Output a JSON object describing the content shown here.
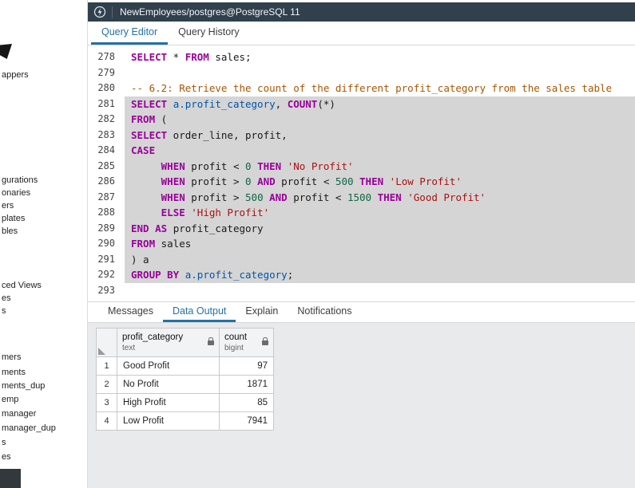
{
  "connection": {
    "title": "NewEmployees/postgres@PostgreSQL 11"
  },
  "editor_tabs": {
    "query_editor": "Query Editor",
    "query_history": "Query History"
  },
  "editor": {
    "selection": {
      "from": 281,
      "to": 292
    },
    "lines": [
      {
        "n": 278,
        "tokens": [
          [
            "kw",
            "SELECT"
          ],
          [
            "pl",
            " * "
          ],
          [
            "kw",
            "FROM"
          ],
          [
            "pl",
            " sales;"
          ]
        ]
      },
      {
        "n": 279,
        "tokens": []
      },
      {
        "n": 280,
        "tokens": [
          [
            "cmt",
            "-- 6.2: Retrieve the count of the different profit_category from the sales table"
          ]
        ]
      },
      {
        "n": 281,
        "tokens": [
          [
            "kw",
            "SELECT"
          ],
          [
            "pl",
            " "
          ],
          [
            "var",
            "a.profit_category"
          ],
          [
            "pl",
            ", "
          ],
          [
            "kw",
            "COUNT"
          ],
          [
            "pl",
            "(*)"
          ]
        ]
      },
      {
        "n": 282,
        "tokens": [
          [
            "kw",
            "FROM"
          ],
          [
            "pl",
            " ("
          ]
        ]
      },
      {
        "n": 283,
        "tokens": [
          [
            "kw",
            "SELECT"
          ],
          [
            "pl",
            " order_line, profit,"
          ]
        ]
      },
      {
        "n": 284,
        "tokens": [
          [
            "kw",
            "CASE"
          ]
        ]
      },
      {
        "n": 285,
        "tokens": [
          [
            "pl",
            "     "
          ],
          [
            "kw",
            "WHEN"
          ],
          [
            "pl",
            " profit < "
          ],
          [
            "num",
            "0"
          ],
          [
            "pl",
            " "
          ],
          [
            "kw",
            "THEN"
          ],
          [
            "pl",
            " "
          ],
          [
            "str",
            "'No Profit'"
          ]
        ]
      },
      {
        "n": 286,
        "tokens": [
          [
            "pl",
            "     "
          ],
          [
            "kw",
            "WHEN"
          ],
          [
            "pl",
            " profit > "
          ],
          [
            "num",
            "0"
          ],
          [
            "pl",
            " "
          ],
          [
            "kw",
            "AND"
          ],
          [
            "pl",
            " profit < "
          ],
          [
            "num",
            "500"
          ],
          [
            "pl",
            " "
          ],
          [
            "kw",
            "THEN"
          ],
          [
            "pl",
            " "
          ],
          [
            "str",
            "'Low Profit'"
          ]
        ]
      },
      {
        "n": 287,
        "tokens": [
          [
            "pl",
            "     "
          ],
          [
            "kw",
            "WHEN"
          ],
          [
            "pl",
            " profit > "
          ],
          [
            "num",
            "500"
          ],
          [
            "pl",
            " "
          ],
          [
            "kw",
            "AND"
          ],
          [
            "pl",
            " profit < "
          ],
          [
            "num",
            "1500"
          ],
          [
            "pl",
            " "
          ],
          [
            "kw",
            "THEN"
          ],
          [
            "pl",
            " "
          ],
          [
            "str",
            "'Good Profit'"
          ]
        ]
      },
      {
        "n": 288,
        "tokens": [
          [
            "pl",
            "     "
          ],
          [
            "kw",
            "ELSE"
          ],
          [
            "pl",
            " "
          ],
          [
            "str",
            "'High Profit'"
          ]
        ]
      },
      {
        "n": 289,
        "tokens": [
          [
            "kw",
            "END"
          ],
          [
            "pl",
            " "
          ],
          [
            "kw",
            "AS"
          ],
          [
            "pl",
            " profit_category"
          ]
        ]
      },
      {
        "n": 290,
        "tokens": [
          [
            "kw",
            "FROM"
          ],
          [
            "pl",
            " sales"
          ]
        ]
      },
      {
        "n": 291,
        "tokens": [
          [
            "pl",
            ") a"
          ]
        ]
      },
      {
        "n": 292,
        "tokens": [
          [
            "kw",
            "GROUP BY"
          ],
          [
            "pl",
            " "
          ],
          [
            "var",
            "a.profit_category"
          ],
          [
            "pl",
            ";"
          ]
        ]
      },
      {
        "n": 293,
        "tokens": []
      }
    ]
  },
  "output": {
    "tabs": [
      "Messages",
      "Data Output",
      "Explain",
      "Notifications"
    ],
    "active_tab": "Data Output",
    "grid": {
      "columns": [
        {
          "name": "profit_category",
          "type": "text"
        },
        {
          "name": "count",
          "type": "bigint"
        }
      ],
      "rows": [
        [
          "Good Profit",
          "97"
        ],
        [
          "No Profit",
          "1871"
        ],
        [
          "High Profit",
          "85"
        ],
        [
          "Low Profit",
          "7941"
        ]
      ]
    }
  },
  "sidebar": {
    "items": [
      "appers",
      "gurations",
      "onaries",
      "ers",
      "plates",
      "bles",
      "ced Views",
      "es",
      "s",
      "mers",
      "ments",
      "ments_dup",
      "emp",
      "manager",
      "manager_dup",
      "s",
      "es"
    ]
  }
}
